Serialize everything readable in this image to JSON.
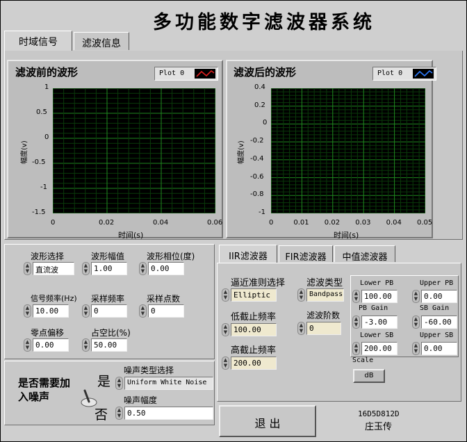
{
  "title": "多功能数字滤波器系统",
  "tabs": [
    "时域信号",
    "滤波信息"
  ],
  "graph1": {
    "title": "滤波前的波形",
    "legend": "Plot 0",
    "ylabel": "幅度(v)",
    "xlabel": "时间(s)",
    "yticks": [
      "1",
      "0.5",
      "0",
      "-0.5",
      "-1",
      "-1.5"
    ],
    "xticks": [
      "0",
      "0.02",
      "0.04",
      "0.06"
    ],
    "color": "#e02020"
  },
  "graph2": {
    "title": "滤波后的波形",
    "legend": "Plot 0",
    "ylabel": "幅度(v)",
    "xlabel": "时间(s)",
    "yticks": [
      "0.4",
      "0.2",
      "0",
      "-0.2",
      "-0.4",
      "-0.6",
      "-0.8",
      "-1"
    ],
    "xticks": [
      "0",
      "0.01",
      "0.02",
      "0.03",
      "0.04",
      "0.05"
    ],
    "color": "#2e7cff"
  },
  "signal": {
    "wave_type_label": "波形选择",
    "wave_type": "直流波",
    "amplitude_label": "波形幅值",
    "amplitude": "1.00",
    "phase_label": "波形相位(度)",
    "phase": "0.00",
    "freq_label": "信号频率(Hz)",
    "freq": "10.00",
    "fs_label": "采样频率",
    "fs": "0",
    "n_label": "采样点数",
    "n": "0",
    "offset_label": "零点偏移",
    "offset": "0.00",
    "duty_label": "占空比(%)",
    "duty": "50.00"
  },
  "noise": {
    "question": "是否需要加入噪声",
    "yes": "是",
    "no": "否",
    "type_label": "噪声类型选择",
    "type": "Uniform White Noise",
    "amp_label": "噪声幅度",
    "amp": "0.50"
  },
  "filter_tabs": [
    "IIR滤波器",
    "FIR滤波器",
    "中值滤波器"
  ],
  "iir": {
    "approx_label": "逼近准则选择",
    "approx": "Elliptic",
    "ftype_label": "滤波类型",
    "ftype": "Bandpass",
    "low_label": "低截止频率",
    "low": "100.00",
    "order_label": "滤波阶数",
    "order": "0",
    "high_label": "高截止频率",
    "high": "200.00",
    "lower_pb_label": "Lower PB",
    "lower_pb": "100.00",
    "upper_pb_label": "Upper PB",
    "upper_pb": "0.00",
    "pb_gain_label": "PB Gain",
    "pb_gain": "-3.00",
    "sb_gain_label": "SB Gain",
    "sb_gain": "-60.00",
    "lower_sb_label": "Lower SB",
    "lower_sb": "200.00",
    "upper_sb_label": "Upper SB",
    "upper_sb": "0.00",
    "scale_label": "Scale",
    "scale_btn": "dB"
  },
  "exit_label": "退  出",
  "author_id": "16D5D812D",
  "author_name": "庄玉传"
}
